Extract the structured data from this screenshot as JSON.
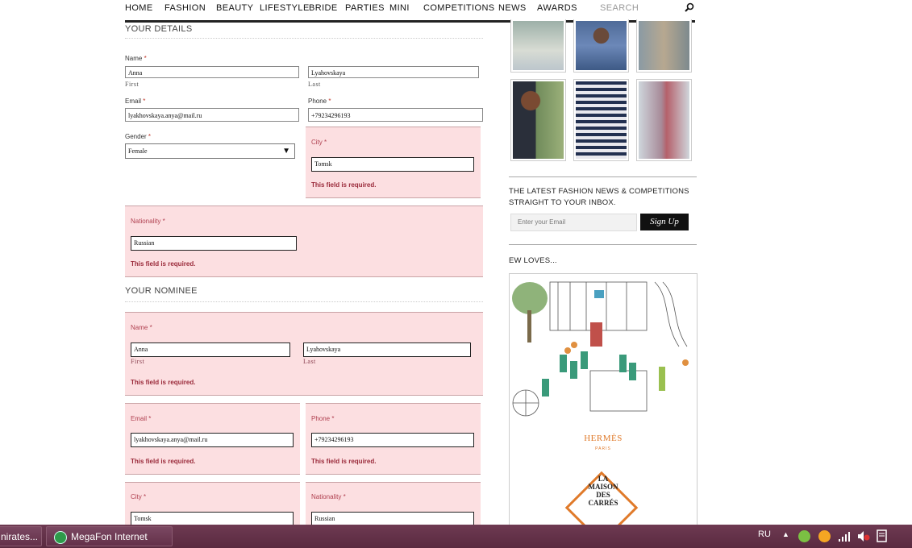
{
  "nav": {
    "items": [
      "HOME",
      "FASHION",
      "BEAUTY",
      "LIFESTYLE",
      "BRIDE",
      "PARTIES",
      "MINI",
      "COMPETITIONS",
      "NEWS",
      "AWARDS"
    ],
    "search_placeholder": "SEARCH"
  },
  "your_details": {
    "heading": "YOUR DETAILS",
    "name_label": "Name",
    "first_value": "Anna",
    "last_value": "Lyahovskaya",
    "first_sub": "First",
    "last_sub": "Last",
    "email_label": "Email",
    "email_value": "lyakhovskaya.anya@mail.ru",
    "phone_label": "Phone",
    "phone_value": "+79234296193",
    "gender_label": "Gender",
    "gender_value": "Female",
    "city_label": "City",
    "city_value": "Tomsk",
    "nationality_label": "Nationality",
    "nationality_value": "Russian",
    "required_mark": "*",
    "error_text": "This field is required."
  },
  "your_nominee": {
    "heading": "YOUR NOMINEE",
    "name_label": "Name",
    "first_value": "Anna",
    "last_value": "Lyahovskaya",
    "first_sub": "First",
    "last_sub": "Last",
    "email_label": "Email",
    "email_value": "lyakhovskaya.anya@mail.ru",
    "phone_label": "Phone",
    "phone_value": "+79234296193",
    "city_label": "City",
    "city_value": "Tomsk",
    "nationality_label": "Nationality",
    "nationality_value": "Russian",
    "error_text": "This field is required."
  },
  "newsletter": {
    "text_line1": "THE LATEST FASHION NEWS & COMPETITIONS",
    "text_line2": "STRAIGHT TO YOUR INBOX.",
    "email_placeholder": "Enter your Email",
    "signup_label": "Sign Up"
  },
  "ew_loves": {
    "heading": "EW LOVES...",
    "brand": "HERMÈS",
    "brand_sub": "PARIS",
    "diamond_lines": [
      "LA",
      "MAISON",
      "DES",
      "CARRÉS"
    ]
  },
  "taskbar": {
    "btn1_label": "nirates...",
    "btn2_label": "MegaFon Internet",
    "lang": "RU"
  },
  "colors": {
    "error_bg": "#fcdfe1",
    "taskbar": "#5a2a40",
    "accent_orange": "#e07a2a"
  }
}
